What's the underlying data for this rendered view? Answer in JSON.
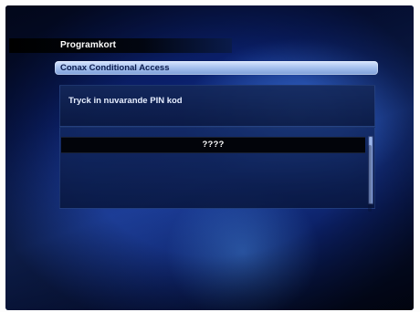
{
  "window": {
    "title": "Programkort"
  },
  "dialog": {
    "header": "Conax Conditional Access",
    "message": "Tryck in nuvarande PIN kod",
    "pin_value": "????"
  },
  "colors": {
    "screen_background": "#0a1f6a",
    "header_bar": "#a9c3ef",
    "panel": "#14285a",
    "pin_row": "#02040a",
    "text_light": "#ffffff"
  }
}
